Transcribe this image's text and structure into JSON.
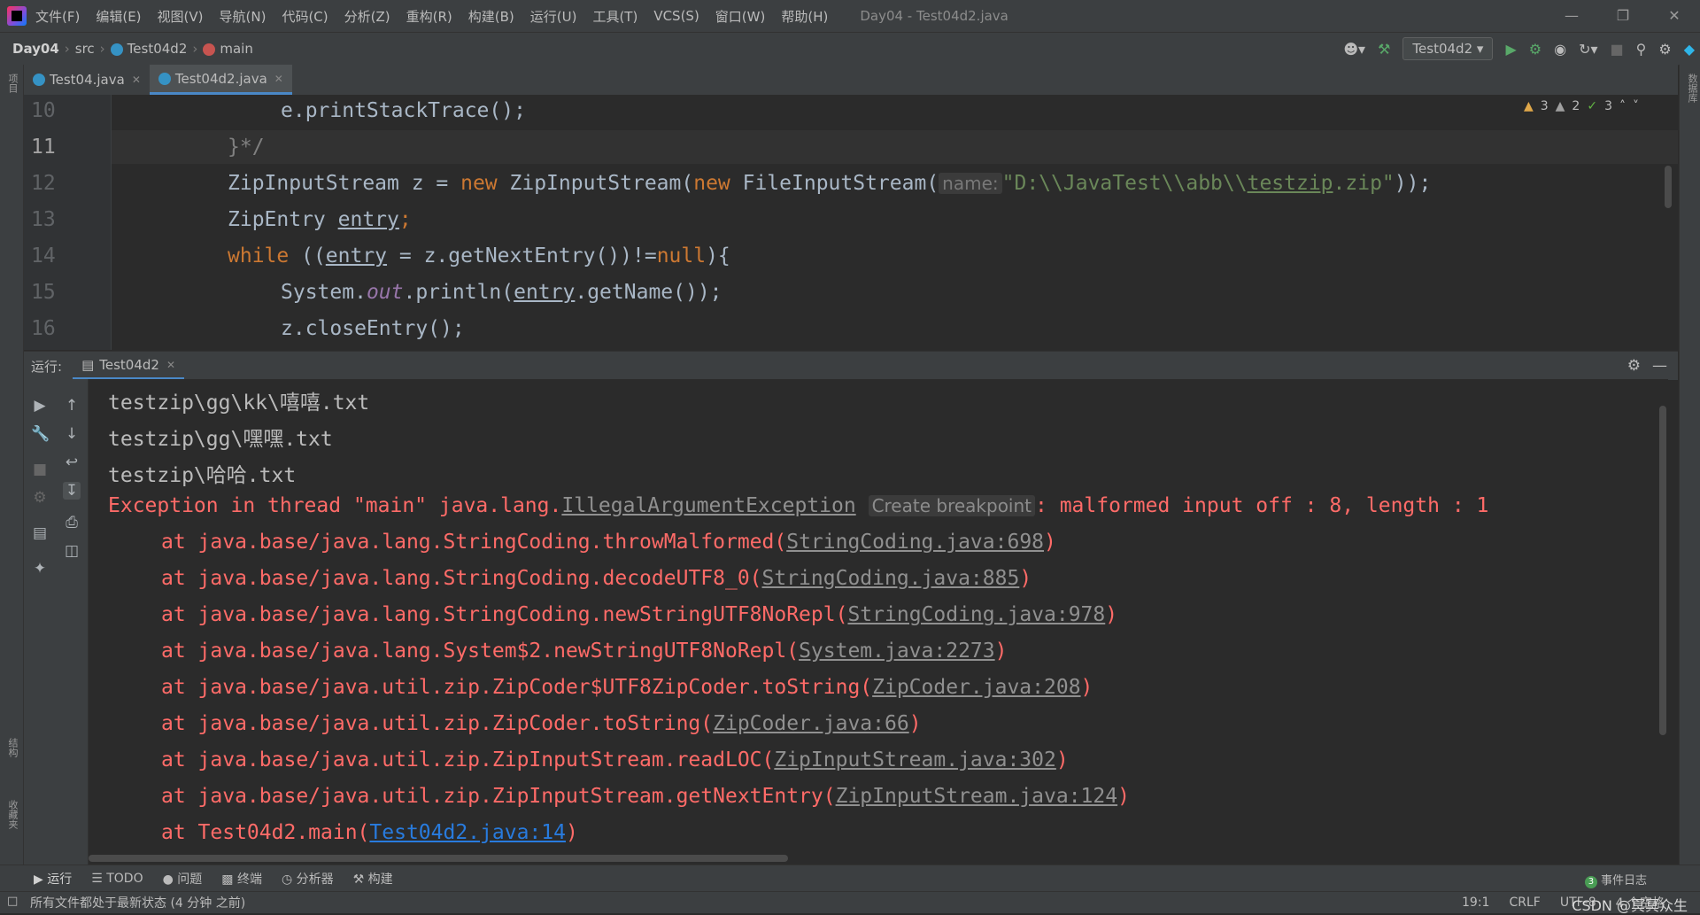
{
  "menu": {
    "items": [
      "文件(F)",
      "编辑(E)",
      "视图(V)",
      "导航(N)",
      "代码(C)",
      "分析(Z)",
      "重构(R)",
      "构建(B)",
      "运行(U)",
      "工具(T)",
      "VCS(S)",
      "窗口(W)",
      "帮助(H)"
    ],
    "window_title": "Day04 - Test04d2.java"
  },
  "nav": {
    "project": "Day04",
    "folder": "src",
    "file": "Test04d2",
    "method": "main",
    "run_config": "Test04d2"
  },
  "tabs": [
    {
      "label": "Test04.java"
    },
    {
      "label": "Test04d2.java"
    }
  ],
  "editor": {
    "line_numbers": [
      "10",
      "11",
      "12",
      "13",
      "14",
      "15",
      "16"
    ],
    "inspections": {
      "warnings": "3",
      "weak_warnings": "2",
      "typos": "3"
    },
    "lines": {
      "l10": "e.printStackTrace();",
      "l11": "}*/",
      "l12_a": "ZipInputStream z = ",
      "l12_new1": "new",
      "l12_b": " ZipInputStream(",
      "l12_new2": "new",
      "l12_c": " FileInputStream(",
      "l12_hint": "name:",
      "l12_str_a": "\"D:\\\\JavaTest\\\\abb\\\\",
      "l12_str_b": "testzip",
      "l12_str_c": ".zip\"",
      "l12_end": "));",
      "l13_a": "ZipEntry ",
      "l13_var": "entry",
      "l13_end": ";",
      "l14_kw": "while",
      "l14_a": " ((",
      "l14_var": "entry",
      "l14_b": " = z.getNextEntry())!=",
      "l14_null": "null",
      "l14_c": "){",
      "l15_a": "System.",
      "l15_out": "out",
      "l15_b": ".println(",
      "l15_var": "entry",
      "l15_c": ".getName());",
      "l16": "z.closeEntry();"
    }
  },
  "run_panel": {
    "label": "运行:",
    "tab": "Test04d2"
  },
  "console": {
    "out": [
      "testzip\\gg\\kk\\嘻嘻.txt",
      "testzip\\gg\\嘿嘿.txt",
      "testzip\\哈哈.txt"
    ],
    "exception_prefix": "Exception in thread \"main\" java.lang.",
    "exception_class": "IllegalArgumentException",
    "breakpoint_hint": "Create breakpoint",
    "exception_msg": ": malformed input off : 8, length : 1",
    "stack": [
      {
        "text": "at java.base/java.lang.StringCoding.throwMalformed(",
        "link": "StringCoding.java:698"
      },
      {
        "text": "at java.base/java.lang.StringCoding.decodeUTF8_0(",
        "link": "StringCoding.java:885"
      },
      {
        "text": "at java.base/java.lang.StringCoding.newStringUTF8NoRepl(",
        "link": "StringCoding.java:978"
      },
      {
        "text": "at java.base/java.lang.System$2.newStringUTF8NoRepl(",
        "link": "System.java:2273"
      },
      {
        "text": "at java.base/java.util.zip.ZipCoder$UTF8ZipCoder.toString(",
        "link": "ZipCoder.java:208"
      },
      {
        "text": "at java.base/java.util.zip.ZipCoder.toString(",
        "link": "ZipCoder.java:66"
      },
      {
        "text": "at java.base/java.util.zip.ZipInputStream.readLOC(",
        "link": "ZipInputStream.java:302"
      },
      {
        "text": "at java.base/java.util.zip.ZipInputStream.getNextEntry(",
        "link": "ZipInputStream.java:124"
      },
      {
        "text": "at Test04d2.main(",
        "link": "Test04d2.java:14"
      }
    ],
    "close_paren": ")"
  },
  "tool_tabs": [
    "运行",
    "TODO",
    "问题",
    "终端",
    "分析器",
    "构建"
  ],
  "event_log": {
    "count": "3",
    "label": "事件日志"
  },
  "left_strip": {
    "top": "项目",
    "mid": "结构",
    "bottom": "收藏夹"
  },
  "right_strip": {
    "top": "数据库"
  },
  "status": {
    "message": "所有文件都处于最新状态 (4 分钟 之前)",
    "position": "19:1",
    "line_sep": "CRLF",
    "encoding": "UTF-8",
    "indent": "4 个空格",
    "watermark": "CSDN @冥冥众生"
  },
  "colors": {
    "error": "#ff6b68",
    "keyword": "#cc7832",
    "string": "#6a8759",
    "link": "#287bde"
  }
}
